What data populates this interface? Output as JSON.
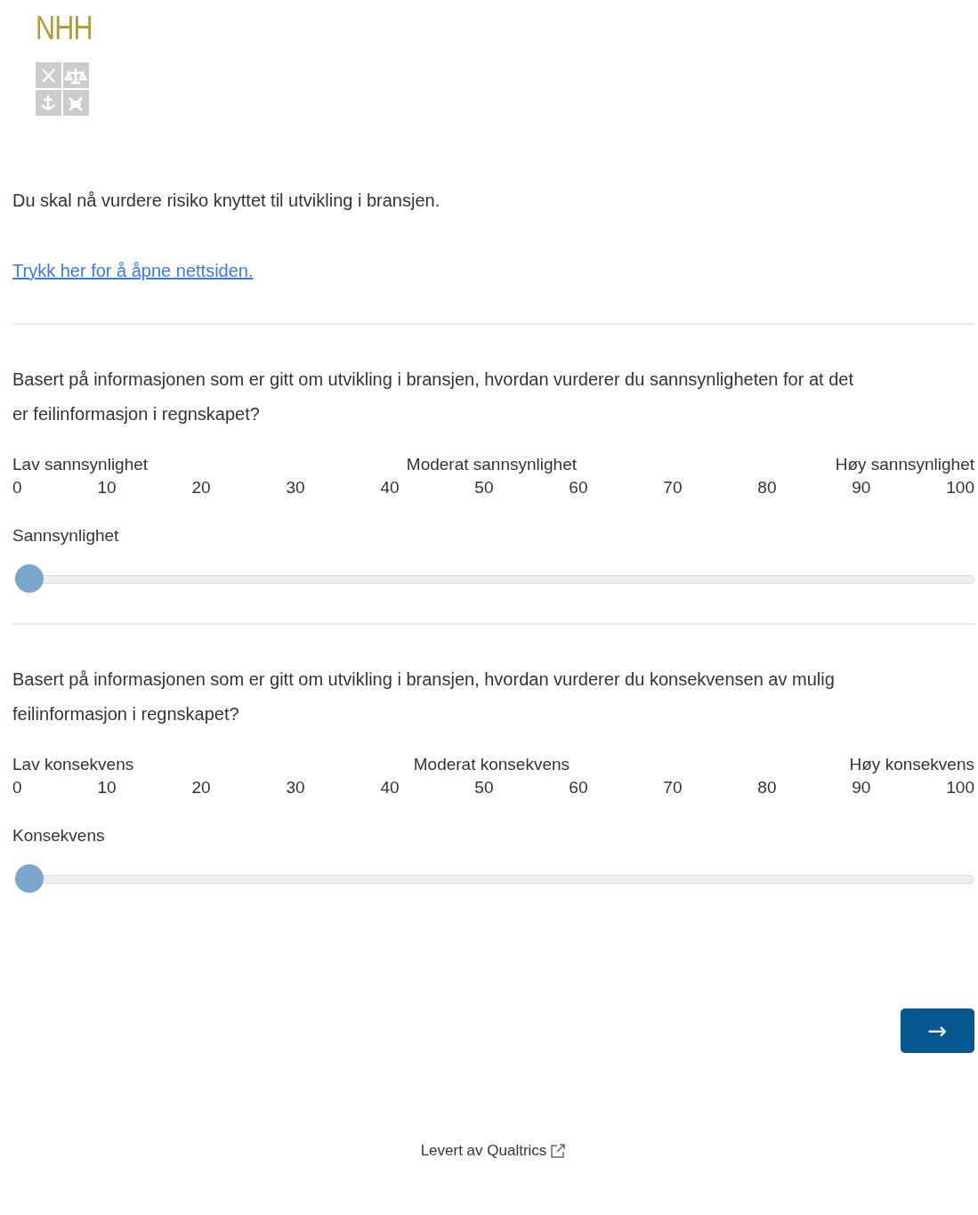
{
  "logo": {
    "text": "NHH"
  },
  "intro": "Du skal nå vurdere risiko knyttet til utvikling i bransjen.",
  "link": "Trykk her for å åpne nettsiden.",
  "questions": [
    {
      "text": "Basert på informasjonen som er gitt om utvikling i bransjen, hvordan vurderer du sannsynligheten for at det er feilinformasjon i regnskapet?",
      "anchors": [
        "Lav sannsynlighet",
        "Moderat sannsynlighet",
        "Høy sannsynlighet"
      ],
      "ticks": [
        "0",
        "10",
        "20",
        "30",
        "40",
        "50",
        "60",
        "70",
        "80",
        "90",
        "100"
      ],
      "label": "Sannsynlighet",
      "level": 0
    },
    {
      "text": "Basert på informasjonen som er gitt om utvikling i bransjen, hvordan vurderer du konsekvensen av mulig feilinformasjon i regnskapet?",
      "anchors": [
        "Lav konsekvens",
        "Moderat konsekvens",
        "Høy konsekvens"
      ],
      "ticks": [
        "0",
        "10",
        "20",
        "30",
        "40",
        "50",
        "60",
        "70",
        "80",
        "90",
        "100"
      ],
      "label": "Konsekvens",
      "level": 0
    }
  ],
  "next_button": "→",
  "footer": "Levert av Qualtrics"
}
